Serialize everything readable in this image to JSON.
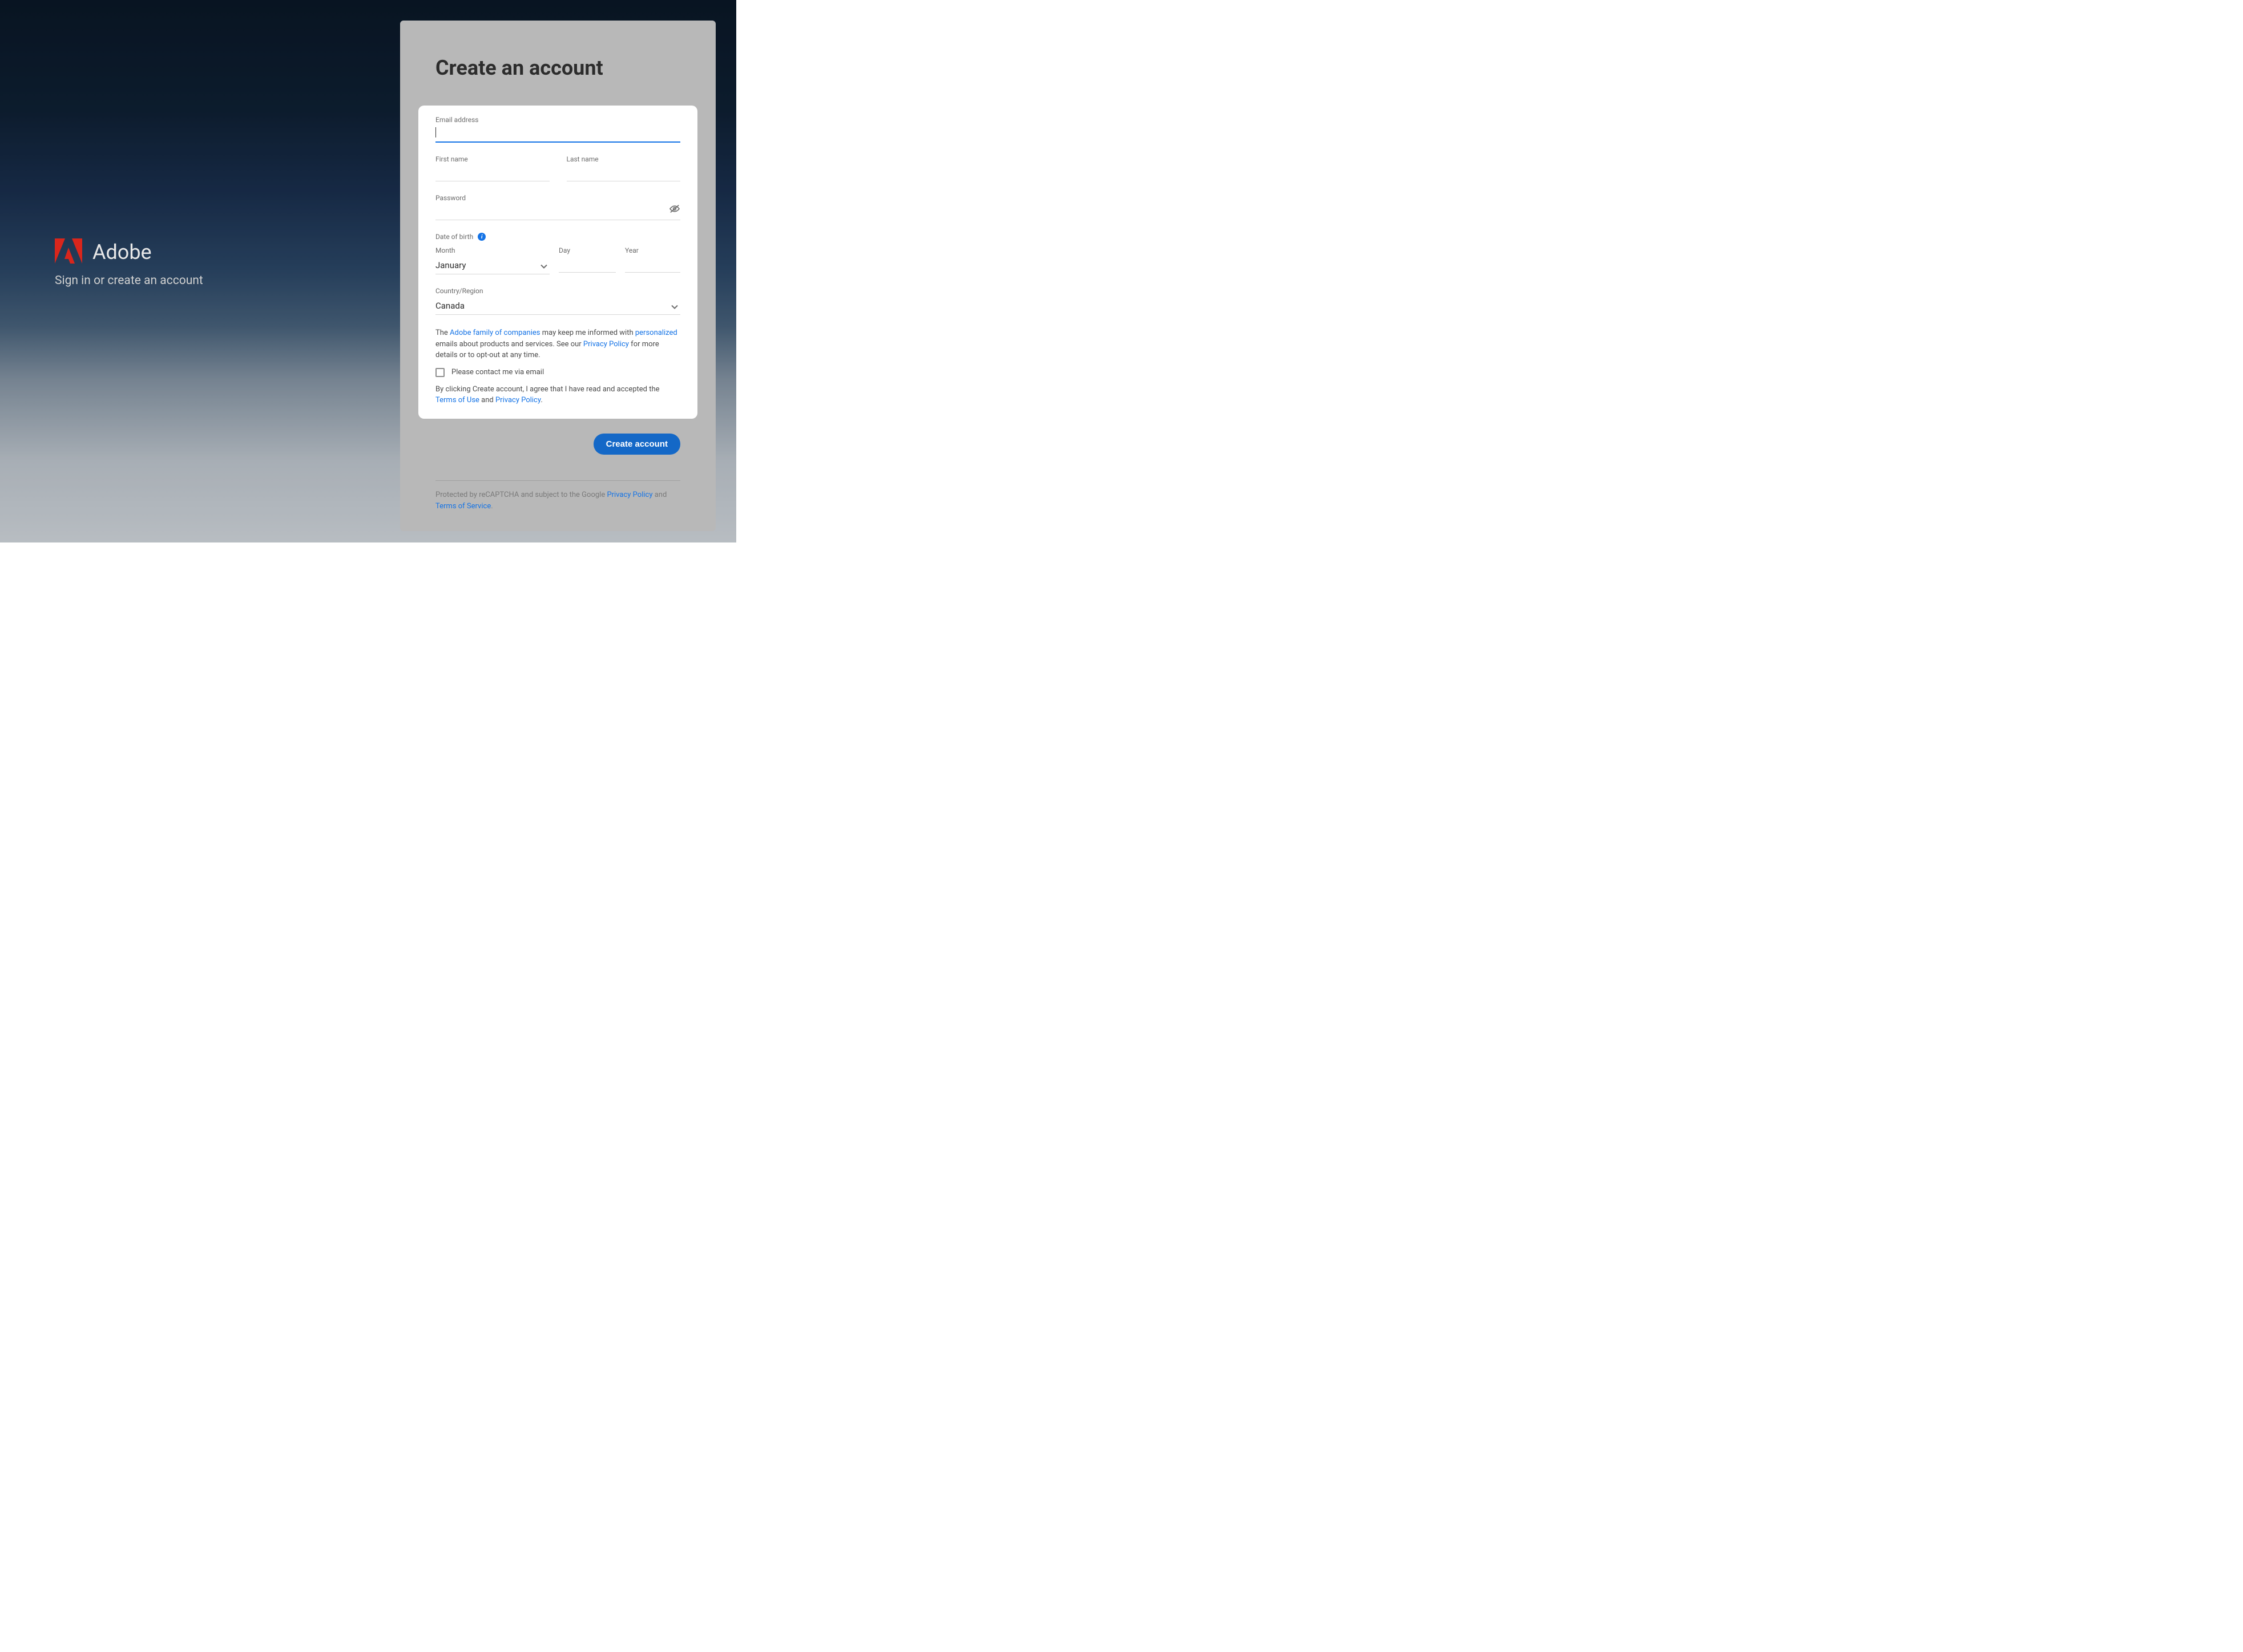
{
  "brand": {
    "name": "Adobe",
    "tagline": "Sign in or create an account"
  },
  "panel": {
    "title": "Create an account"
  },
  "form": {
    "email_label": "Email address",
    "first_name_label": "First name",
    "last_name_label": "Last name",
    "password_label": "Password",
    "dob_label": "Date of birth",
    "month_label": "Month",
    "month_value": "January",
    "day_label": "Day",
    "year_label": "Year",
    "country_label": "Country/Region",
    "country_value": "Canada"
  },
  "consent": {
    "prefix": "The ",
    "adobe_family": "Adobe family of companies",
    "mid1": " may keep me informed with ",
    "personalized": "personalized",
    "mid2": " emails about products and services. See our ",
    "privacy_policy": "Privacy Policy",
    "suffix": " for more details or to opt-out at any time."
  },
  "checkbox": {
    "label": "Please contact me via email"
  },
  "legal": {
    "prefix": "By clicking Create account, I agree that I have read and accepted the ",
    "terms": "Terms of Use",
    "mid": " and ",
    "privacy": "Privacy Policy",
    "suffix": "."
  },
  "button": {
    "create": "Create account"
  },
  "recaptcha": {
    "prefix": "Protected by reCAPTCHA and subject to the Google ",
    "privacy": "Privacy Policy",
    "mid": " and ",
    "terms": "Terms of Service",
    "suffix": "."
  }
}
